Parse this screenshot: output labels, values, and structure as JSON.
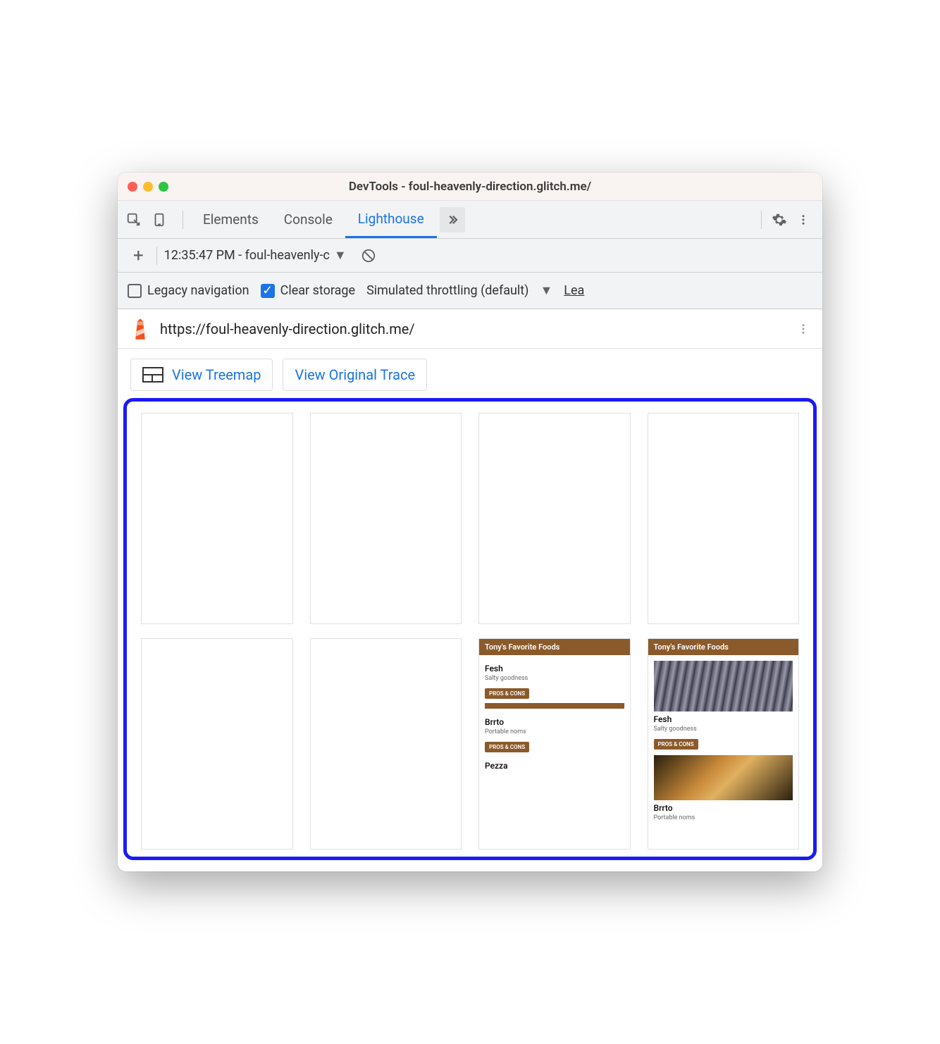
{
  "window": {
    "title": "DevTools - foul-heavenly-direction.glitch.me/"
  },
  "tabs": {
    "items": [
      "Elements",
      "Console",
      "Lighthouse"
    ],
    "active_index": 2
  },
  "report_toolbar": {
    "selected": "12:35:47 PM - foul-heavenly-c"
  },
  "options": {
    "legacy_nav": {
      "label": "Legacy navigation",
      "checked": false
    },
    "clear_storage": {
      "label": "Clear storage",
      "checked": true
    },
    "throttling": "Simulated throttling (default)",
    "learn_more_truncated": "Lea"
  },
  "url": "https://foul-heavenly-direction.glitch.me/",
  "actions": {
    "view_treemap": "View Treemap",
    "view_original_trace": "View Original Trace"
  },
  "filmstrip": {
    "frames": [
      {
        "blank": true
      },
      {
        "blank": true
      },
      {
        "blank": true
      },
      {
        "blank": true
      },
      {
        "blank": true
      },
      {
        "blank": true
      },
      {
        "blank": false,
        "header": "Tony's Favorite Foods",
        "items": [
          {
            "title": "Fesh",
            "sub": "Salty goodness",
            "btn": "PROS & CONS",
            "img": "strip"
          },
          {
            "title": "Brrto",
            "sub": "Portable noms",
            "btn": "PROS & CONS",
            "img": null
          },
          {
            "title": "Pezza",
            "sub": "",
            "btn": null,
            "img": null
          }
        ]
      },
      {
        "blank": false,
        "header": "Tony's Favorite Foods",
        "items": [
          {
            "title": "Fesh",
            "sub": "Salty goodness",
            "btn": "PROS & CONS",
            "img": "fish",
            "img_first": true
          },
          {
            "title": "Brrto",
            "sub": "Portable noms",
            "btn": null,
            "img": "brrto",
            "img_first": true
          }
        ]
      }
    ]
  }
}
